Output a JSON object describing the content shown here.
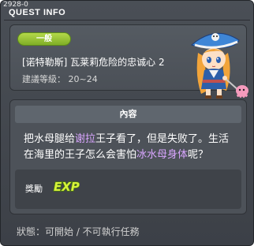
{
  "window": {
    "quest_id": "2928-0",
    "title": "QUEST INFO"
  },
  "header": {
    "category": "一般",
    "quest_name": "[诺特勒斯] 瓦莱莉危险的忠诚心 2",
    "level_label": "建議等級",
    "level_range": "20~24",
    "level_text": "建議等級： 20~24",
    "npc_icon": "pirate-girl-npc-icon"
  },
  "content": {
    "header": "內容",
    "text_part1": "把水母腿给",
    "text_highlight1": "谢拉",
    "text_part2": "王子看了，但是失败了。生活在海里的王子怎么会害怕",
    "text_highlight2": "冰水母身体",
    "text_part3": "呢？",
    "highlight_color": "#d9a6ff"
  },
  "reward": {
    "label": "獎勵",
    "exp_icon": "exp-icon",
    "exp_text": "EXP"
  },
  "status": {
    "text": "狀態：可開始 / 不可執行任務"
  }
}
